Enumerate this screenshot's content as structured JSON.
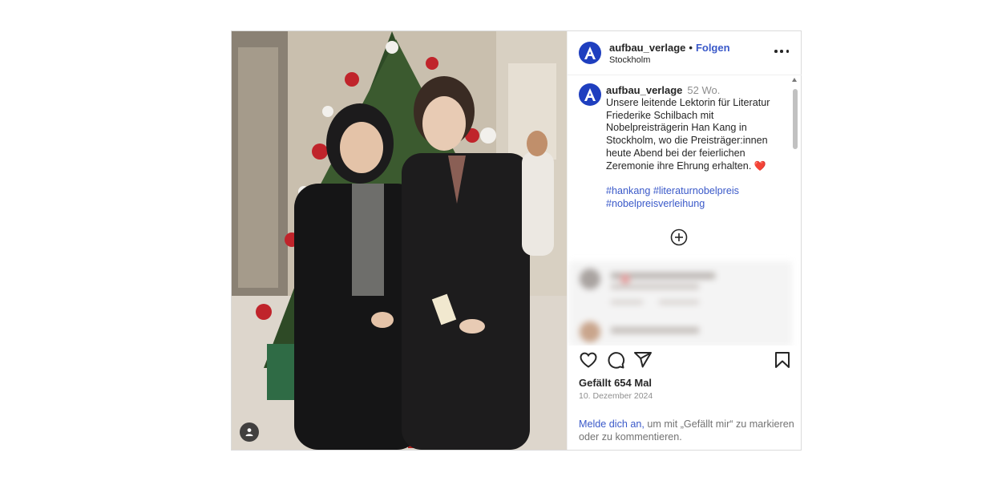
{
  "header": {
    "username": "aufbau_verlage",
    "separator": "•",
    "follow_label": "Folgen",
    "location": "Stockholm",
    "more_icon": "more-horizontal-icon"
  },
  "caption": {
    "username": "aufbau_verlage",
    "time": "52 Wo.",
    "text": "Unsere leitende Lektorin für Literatur Friederike Schilbach mit Nobelpreisträgerin Han Kang in Stockholm, wo die Preisträger:innen heute Abend bei der feierlichen Zeremonie ihre Ehrung erhalten.",
    "emoji": "❤️",
    "hashtags": [
      "#hankang",
      "#literaturnobelpreis",
      "#nobelpreisverleihung"
    ]
  },
  "actions": {
    "like_icon": "heart-icon",
    "comment_icon": "comment-icon",
    "share_icon": "send-icon",
    "save_icon": "bookmark-icon"
  },
  "likes_text": "Gefällt 654 Mal",
  "date": "10. Dezember 2024",
  "login_prompt": {
    "link": "Melde dich an,",
    "text": " um mit „Gefällt mir“ zu markieren oder zu kommentieren."
  },
  "colors": {
    "brand_avatar": "#1f3fbf",
    "link": "#3a59c9",
    "muted": "#8e8e8e",
    "border": "#dbdbdb"
  }
}
